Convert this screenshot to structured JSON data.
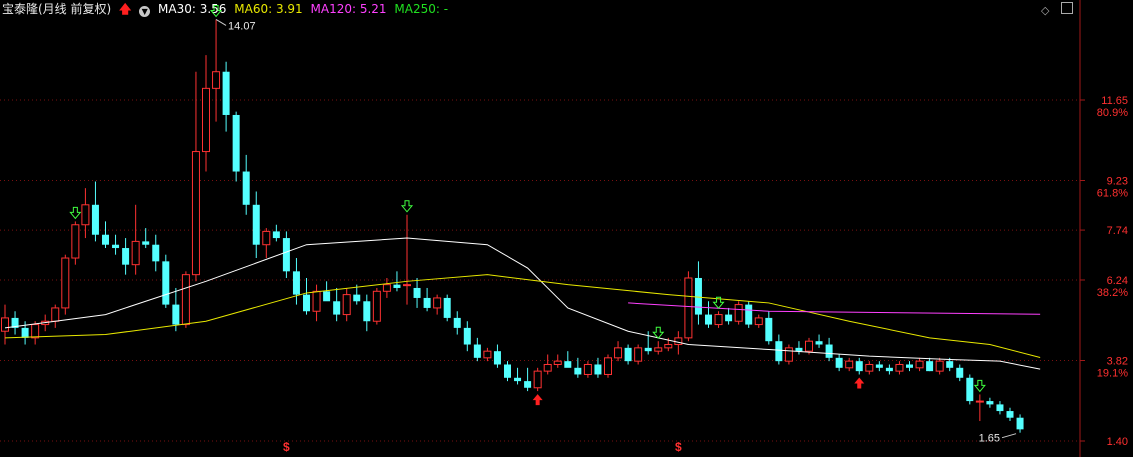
{
  "header": {
    "title": "宝泰隆(月线 前复权)",
    "ma30": "MA30: 3.56",
    "ma60": "MA60: 3.91",
    "ma120": "MA120: 5.21",
    "ma250": "MA250: -"
  },
  "chart_data": {
    "type": "candlestick",
    "period": "monthly",
    "y_axis": {
      "ticks": [
        11.65,
        9.23,
        7.74,
        6.24,
        3.82,
        1.4
      ],
      "tick_labels": [
        "11.65",
        "9.23",
        "7.74",
        "6.24",
        "3.82",
        "1.40"
      ],
      "pct_labels": [
        {
          "price": 11.65,
          "label": "80.9%"
        },
        {
          "price": 9.23,
          "label": "61.8%"
        },
        {
          "price": 6.24,
          "label": "38.2%"
        },
        {
          "price": 3.82,
          "label": "19.1%"
        }
      ],
      "ylim": [
        1.4,
        14.07
      ]
    },
    "annotations": {
      "max_label": "14.07",
      "min_label": "1.65",
      "dividend_marker": "$"
    },
    "candles": [
      [
        4.7,
        5.5,
        4.3,
        5.1
      ],
      [
        5.1,
        5.3,
        4.6,
        4.8
      ],
      [
        4.8,
        5.0,
        4.3,
        4.5
      ],
      [
        4.5,
        5.0,
        4.3,
        4.9
      ],
      [
        4.9,
        5.2,
        4.7,
        5.0
      ],
      [
        5.0,
        5.5,
        4.8,
        5.4
      ],
      [
        5.4,
        7.0,
        5.2,
        6.9
      ],
      [
        6.9,
        8.0,
        6.7,
        7.9
      ],
      [
        7.9,
        9.0,
        7.5,
        8.5
      ],
      [
        8.5,
        9.2,
        7.4,
        7.6
      ],
      [
        7.6,
        8.0,
        7.2,
        7.3
      ],
      [
        7.3,
        7.6,
        7.0,
        7.2
      ],
      [
        7.2,
        7.5,
        6.4,
        6.7
      ],
      [
        6.7,
        8.5,
        6.4,
        7.4
      ],
      [
        7.4,
        7.8,
        7.2,
        7.3
      ],
      [
        7.3,
        7.6,
        6.5,
        6.8
      ],
      [
        6.8,
        7.0,
        5.4,
        5.5
      ],
      [
        5.5,
        6.0,
        4.7,
        4.9
      ],
      [
        4.9,
        6.5,
        4.8,
        6.4
      ],
      [
        6.4,
        12.5,
        6.2,
        10.1
      ],
      [
        10.1,
        13.0,
        9.5,
        12.0
      ],
      [
        12.0,
        14.07,
        11.0,
        12.5
      ],
      [
        12.5,
        12.8,
        10.7,
        11.2
      ],
      [
        11.2,
        11.3,
        9.2,
        9.5
      ],
      [
        9.5,
        10.0,
        8.2,
        8.5
      ],
      [
        8.5,
        8.9,
        6.9,
        7.3
      ],
      [
        7.3,
        7.8,
        6.9,
        7.7
      ],
      [
        7.7,
        7.9,
        7.4,
        7.5
      ],
      [
        7.5,
        7.7,
        6.3,
        6.5
      ],
      [
        6.5,
        6.9,
        5.5,
        5.8
      ],
      [
        5.8,
        6.3,
        5.2,
        5.3
      ],
      [
        5.3,
        6.1,
        5.0,
        5.9
      ],
      [
        5.9,
        6.2,
        5.7,
        5.6
      ],
      [
        5.6,
        6.0,
        5.0,
        5.2
      ],
      [
        5.2,
        6.0,
        5.0,
        5.8
      ],
      [
        5.8,
        6.1,
        5.5,
        5.6
      ],
      [
        5.6,
        5.8,
        4.7,
        5.0
      ],
      [
        5.0,
        6.0,
        4.9,
        5.9
      ],
      [
        5.9,
        6.3,
        5.7,
        6.1
      ],
      [
        6.1,
        6.5,
        5.9,
        6.0
      ],
      [
        6.1,
        8.2,
        5.5,
        6.1
      ],
      [
        6.0,
        6.3,
        5.4,
        5.7
      ],
      [
        5.7,
        6.0,
        5.3,
        5.4
      ],
      [
        5.4,
        5.8,
        5.2,
        5.7
      ],
      [
        5.7,
        5.8,
        5.0,
        5.1
      ],
      [
        5.1,
        5.3,
        4.6,
        4.8
      ],
      [
        4.8,
        5.0,
        4.1,
        4.3
      ],
      [
        4.3,
        4.5,
        3.8,
        3.9
      ],
      [
        3.9,
        4.2,
        3.8,
        4.1
      ],
      [
        4.1,
        4.3,
        3.6,
        3.7
      ],
      [
        3.7,
        3.8,
        3.2,
        3.3
      ],
      [
        3.3,
        3.6,
        3.1,
        3.2
      ],
      [
        3.2,
        3.6,
        2.9,
        3.0
      ],
      [
        3.0,
        3.6,
        2.9,
        3.5
      ],
      [
        3.5,
        4.0,
        3.4,
        3.7
      ],
      [
        3.7,
        4.0,
        3.6,
        3.8
      ],
      [
        3.8,
        4.1,
        3.7,
        3.6
      ],
      [
        3.6,
        3.9,
        3.3,
        3.4
      ],
      [
        3.4,
        3.8,
        3.3,
        3.7
      ],
      [
        3.7,
        3.9,
        3.3,
        3.4
      ],
      [
        3.4,
        4.0,
        3.3,
        3.9
      ],
      [
        3.9,
        4.4,
        3.8,
        4.2
      ],
      [
        4.2,
        4.3,
        3.7,
        3.8
      ],
      [
        3.8,
        4.3,
        3.7,
        4.2
      ],
      [
        4.2,
        4.7,
        4.0,
        4.1
      ],
      [
        4.1,
        4.4,
        4.0,
        4.2
      ],
      [
        4.2,
        4.5,
        4.1,
        4.3
      ],
      [
        4.3,
        4.7,
        4.0,
        4.5
      ],
      [
        4.5,
        6.5,
        4.4,
        6.3
      ],
      [
        6.3,
        6.8,
        4.9,
        5.2
      ],
      [
        5.2,
        5.6,
        4.8,
        4.9
      ],
      [
        4.9,
        5.3,
        4.8,
        5.2
      ],
      [
        5.2,
        5.4,
        4.9,
        5.0
      ],
      [
        5.0,
        5.6,
        4.9,
        5.5
      ],
      [
        5.5,
        5.6,
        4.8,
        4.9
      ],
      [
        4.9,
        5.2,
        4.8,
        5.1
      ],
      [
        5.1,
        5.3,
        4.3,
        4.4
      ],
      [
        4.4,
        4.6,
        3.7,
        3.8
      ],
      [
        3.8,
        4.3,
        3.7,
        4.2
      ],
      [
        4.2,
        4.4,
        4.0,
        4.1
      ],
      [
        4.1,
        4.5,
        4.0,
        4.4
      ],
      [
        4.4,
        4.6,
        4.2,
        4.3
      ],
      [
        4.3,
        4.5,
        3.8,
        3.9
      ],
      [
        3.9,
        4.0,
        3.5,
        3.6
      ],
      [
        3.6,
        3.9,
        3.5,
        3.8
      ],
      [
        3.8,
        3.9,
        3.4,
        3.5
      ],
      [
        3.5,
        3.8,
        3.4,
        3.7
      ],
      [
        3.7,
        3.8,
        3.5,
        3.6
      ],
      [
        3.6,
        3.7,
        3.4,
        3.5
      ],
      [
        3.5,
        3.8,
        3.4,
        3.7
      ],
      [
        3.7,
        3.8,
        3.5,
        3.6
      ],
      [
        3.6,
        3.9,
        3.5,
        3.8
      ],
      [
        3.8,
        3.9,
        3.5,
        3.5
      ],
      [
        3.5,
        3.9,
        3.4,
        3.8
      ],
      [
        3.8,
        3.9,
        3.5,
        3.6
      ],
      [
        3.6,
        3.7,
        3.2,
        3.3
      ],
      [
        3.3,
        3.4,
        2.5,
        2.6
      ],
      [
        2.6,
        2.8,
        2.0,
        2.6
      ],
      [
        2.6,
        2.7,
        2.4,
        2.5
      ],
      [
        2.5,
        2.6,
        2.2,
        2.3
      ],
      [
        2.3,
        2.4,
        2.0,
        2.1
      ],
      [
        2.1,
        2.2,
        1.65,
        1.75
      ]
    ],
    "series": [
      {
        "name": "MA30",
        "color": "#ffffff",
        "values": [
          [
            0,
            4.8
          ],
          [
            10,
            5.2
          ],
          [
            20,
            6.2
          ],
          [
            30,
            7.3
          ],
          [
            40,
            7.5
          ],
          [
            48,
            7.3
          ],
          [
            52,
            6.6
          ],
          [
            56,
            5.4
          ],
          [
            62,
            4.7
          ],
          [
            68,
            4.3
          ],
          [
            76,
            4.15
          ],
          [
            86,
            3.95
          ],
          [
            94,
            3.85
          ],
          [
            99,
            3.8
          ],
          [
            103,
            3.56
          ]
        ]
      },
      {
        "name": "MA60",
        "color": "#e8e800",
        "values": [
          [
            0,
            4.5
          ],
          [
            10,
            4.6
          ],
          [
            20,
            5.0
          ],
          [
            30,
            5.85
          ],
          [
            40,
            6.2
          ],
          [
            48,
            6.4
          ],
          [
            56,
            6.1
          ],
          [
            66,
            5.8
          ],
          [
            76,
            5.55
          ],
          [
            84,
            5.0
          ],
          [
            92,
            4.5
          ],
          [
            98,
            4.3
          ],
          [
            103,
            3.91
          ]
        ]
      },
      {
        "name": "MA120",
        "color": "#ff40ff",
        "values": [
          [
            62,
            5.55
          ],
          [
            76,
            5.3
          ],
          [
            103,
            5.21
          ]
        ]
      },
      {
        "name": "MA250",
        "color": "#20e020",
        "values": []
      }
    ],
    "signals": [
      {
        "index": 7,
        "type": "sell"
      },
      {
        "index": 21,
        "type": "sell"
      },
      {
        "index": 40,
        "type": "sell"
      },
      {
        "index": 53,
        "type": "buy"
      },
      {
        "index": 65,
        "type": "sell"
      },
      {
        "index": 71,
        "type": "sell"
      },
      {
        "index": 85,
        "type": "buy"
      },
      {
        "index": 97,
        "type": "sell"
      }
    ],
    "dividends": [
      28,
      67
    ]
  }
}
